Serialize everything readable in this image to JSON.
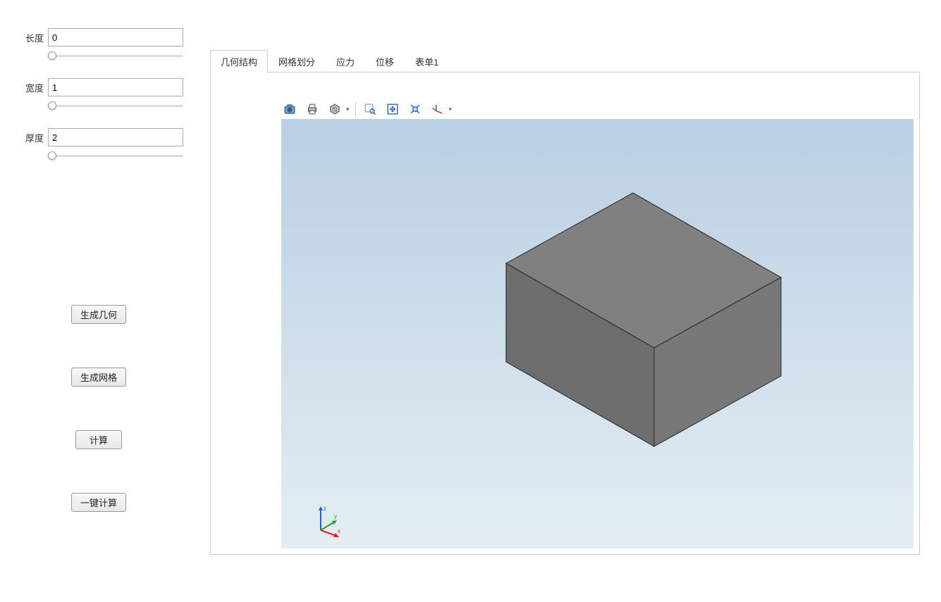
{
  "sidebar": {
    "fields": {
      "length": {
        "label": "长度",
        "value": "0"
      },
      "width": {
        "label": "宽度",
        "value": "1"
      },
      "thickness": {
        "label": "厚度",
        "value": "2"
      }
    },
    "buttons": {
      "gen_geometry": "生成几何",
      "gen_mesh": "生成网格",
      "compute": "计算",
      "one_click": "一键计算"
    }
  },
  "tabs": {
    "geometry": "几何结构",
    "mesh": "网格划分",
    "stress": "应力",
    "displacement": "位移",
    "form1": "表单1"
  },
  "toolbar_icons": {
    "camera": "camera-icon",
    "print": "print-icon",
    "hexagon": "hexagon-icon",
    "zoom_box": "zoom-box-icon",
    "fit": "fit-extents-icon",
    "reset_view": "reset-view-icon",
    "axes": "axes-icon"
  },
  "axis_labels": {
    "x": "x",
    "y": "y",
    "z": "z"
  }
}
